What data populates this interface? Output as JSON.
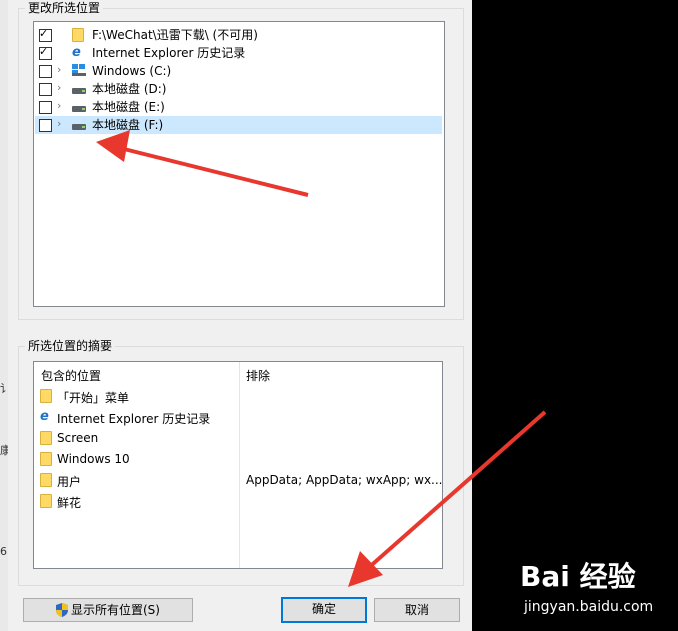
{
  "background": {
    "fragments": [
      "讠",
      "康",
      "6"
    ]
  },
  "change_section": {
    "title": "更改所选位置",
    "items": [
      {
        "label": "F:\\WeChat\\迅雷下载\\ (不可用)",
        "checked": true,
        "icon": "folder-icon",
        "expandable": false
      },
      {
        "label": "Internet Explorer 历史记录",
        "checked": true,
        "icon": "internet-explorer-icon",
        "expandable": false
      },
      {
        "label": "Windows (C:)",
        "checked": false,
        "icon": "windows-drive-icon",
        "expandable": true
      },
      {
        "label": "本地磁盘 (D:)",
        "checked": false,
        "icon": "drive-icon",
        "expandable": true
      },
      {
        "label": "本地磁盘 (E:)",
        "checked": false,
        "icon": "drive-icon",
        "expandable": true
      },
      {
        "label": "本地磁盘 (F:)",
        "checked": false,
        "icon": "drive-icon",
        "expandable": true,
        "selected": true
      }
    ]
  },
  "summary_section": {
    "title": "所选位置的摘要",
    "columns": [
      "包含的位置",
      "排除"
    ],
    "rows": [
      {
        "included": "「开始」菜单",
        "excluded": "",
        "icon": "folder-icon"
      },
      {
        "included": "Internet Explorer 历史记录",
        "excluded": "",
        "icon": "internet-explorer-icon"
      },
      {
        "included": "Screen",
        "excluded": "",
        "icon": "folder-icon"
      },
      {
        "included": "Windows 10",
        "excluded": "",
        "icon": "folder-icon"
      },
      {
        "included": "用户",
        "excluded": "AppData; AppData; wxApp; wx...",
        "icon": "folder-icon"
      },
      {
        "included": "鲜花",
        "excluded": "",
        "icon": "folder-icon"
      }
    ]
  },
  "buttons": {
    "show_all": "显示所有位置(S)",
    "ok": "确定",
    "cancel": "取消"
  },
  "check_mark": "✓",
  "chevron": "›",
  "ie_glyph": "e",
  "watermark": {
    "logo": "Bai  经验",
    "sub": "jingyan.baidu.com"
  },
  "colors": {
    "accent": "#0078d7",
    "selection": "#cce8ff",
    "annotation_arrow": "#e8372c"
  }
}
